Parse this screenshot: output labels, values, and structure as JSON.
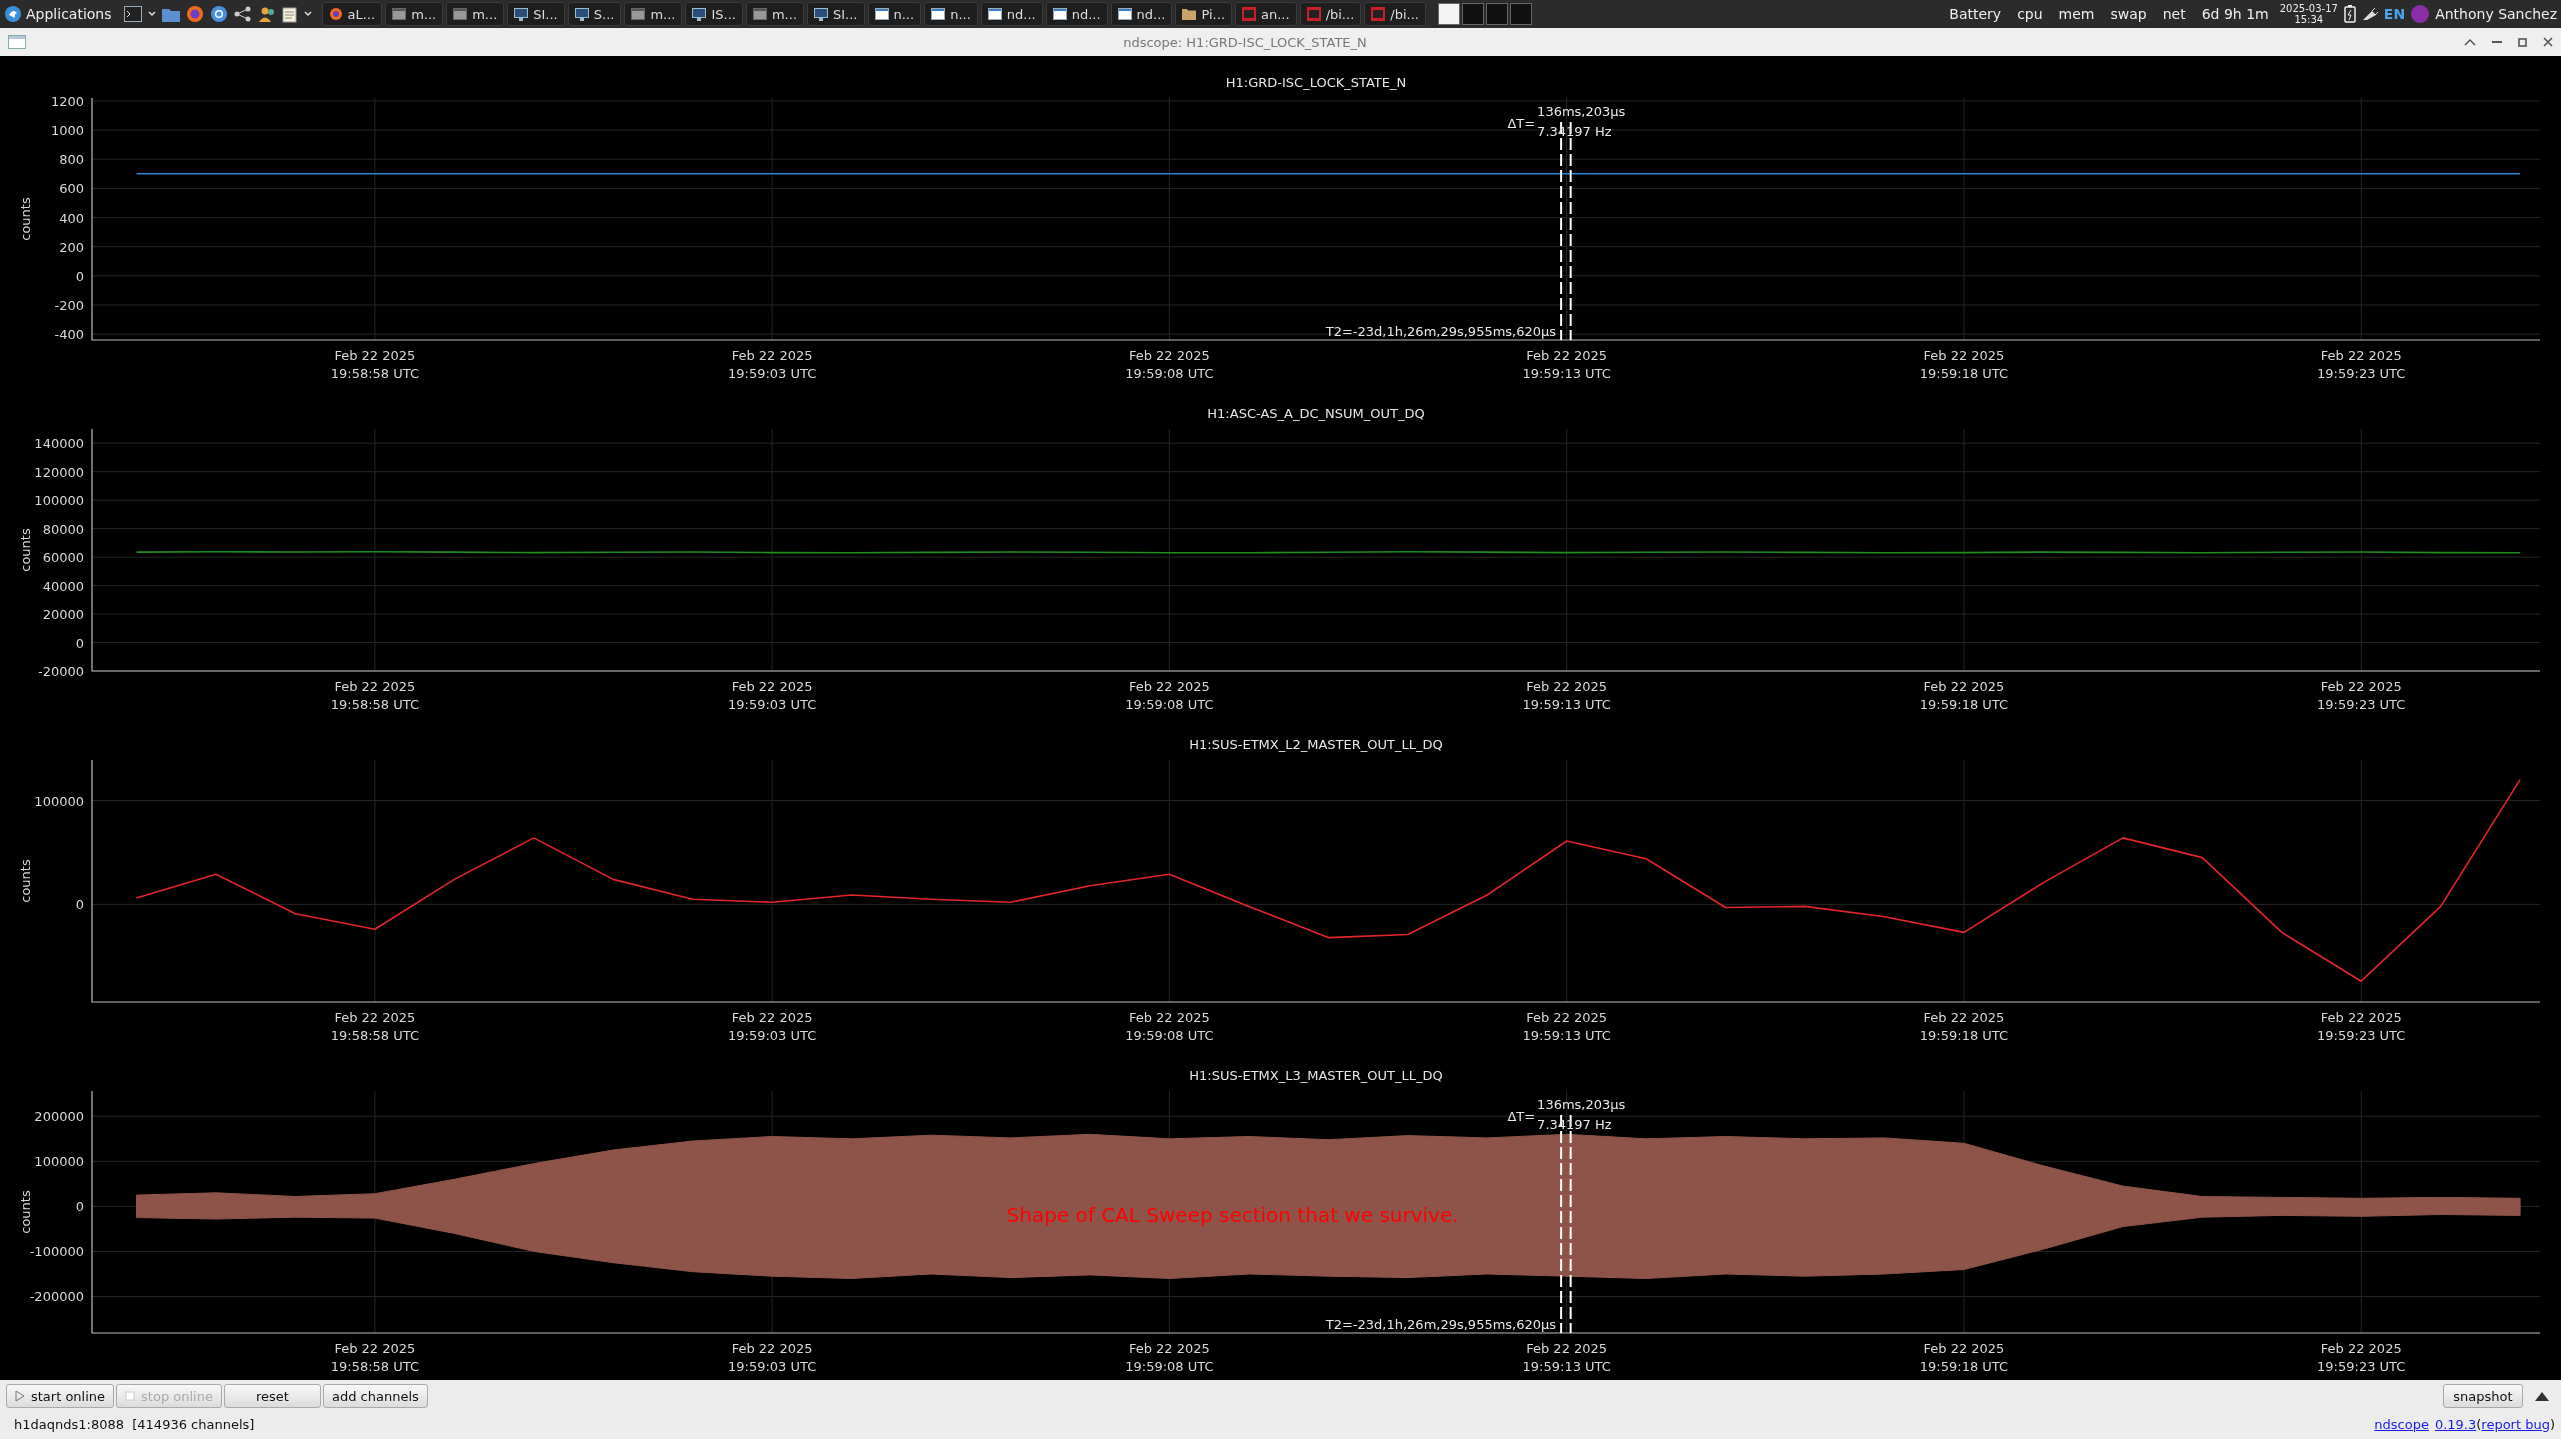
{
  "taskbar": {
    "menu": "Applications",
    "tasks": [
      {
        "kind": "browser",
        "label": "aL..."
      },
      {
        "kind": "window",
        "label": "m..."
      },
      {
        "kind": "window",
        "label": "m..."
      },
      {
        "kind": "monitor",
        "label": "SI..."
      },
      {
        "kind": "monitor",
        "label": "S..."
      },
      {
        "kind": "window",
        "label": "m..."
      },
      {
        "kind": "monitor",
        "label": "IS..."
      },
      {
        "kind": "window",
        "label": "m..."
      },
      {
        "kind": "monitor",
        "label": "SI..."
      },
      {
        "kind": "doc",
        "label": "n..."
      },
      {
        "kind": "doc",
        "label": "n..."
      },
      {
        "kind": "doc",
        "label": "nd..."
      },
      {
        "kind": "doc",
        "label": "nd..."
      },
      {
        "kind": "doc",
        "label": "nd..."
      },
      {
        "kind": "folder",
        "label": "Pi..."
      },
      {
        "kind": "terminal",
        "label": "an..."
      },
      {
        "kind": "terminal",
        "label": "/bi..."
      },
      {
        "kind": "terminal",
        "label": "/bi..."
      }
    ],
    "workspaces": [
      {
        "selected": true
      },
      {
        "selected": false
      },
      {
        "selected": false
      },
      {
        "selected": false
      }
    ],
    "indicators": [
      "Battery",
      "cpu",
      "mem",
      "swap",
      "net"
    ],
    "uptime": "6d 9h 1m",
    "date": "2025-03-17",
    "time": "15:34",
    "keyboard": "EN",
    "user": "Anthony Sanchez"
  },
  "window": {
    "title": "ndscope: H1:GRD-ISC_LOCK_STATE_N"
  },
  "plots": [
    {
      "title": "H1:GRD-ISC_LOCK_STATE_N",
      "chart_data": {
        "type": "line",
        "ylabel": "counts",
        "ylim": [
          -440,
          1220
        ],
        "categories": [
          null,
          null,
          null,
          "Feb 22 2025\n19:58:58 UTC",
          null,
          null,
          null,
          null,
          "Feb 22 2025\n19:59:03 UTC",
          null,
          null,
          null,
          null,
          "Feb 22 2025\n19:59:08 UTC",
          null,
          null,
          null,
          null,
          "Feb 22 2025\n19:59:13 UTC",
          null,
          null,
          null,
          null,
          "Feb 22 2025\n19:59:18 UTC",
          null,
          null,
          null,
          null,
          "Feb 22 2025\n19:59:23 UTC",
          null,
          null
        ],
        "series": [
          {
            "color": "#2f86d0",
            "values": [
              700,
              700,
              700,
              700,
              700,
              700,
              700,
              700,
              700,
              700,
              700,
              700,
              700,
              700,
              700,
              700,
              700,
              700,
              700,
              700,
              700,
              700,
              700,
              700,
              700,
              700,
              700,
              700,
              700,
              700,
              700
            ]
          }
        ],
        "yticks": [
          -400,
          -200,
          0,
          200,
          400,
          600,
          800,
          1000,
          1200
        ],
        "grid": true
      },
      "cursor_readout": {
        "delta_label": "ΔT=",
        "delta": "136ms,203μs",
        "frequency": "7.34197 Hz",
        "t2": "T2=-23d,1h,26m,29s,955ms,620μs"
      }
    },
    {
      "title": "H1:ASC-AS_A_DC_NSUM_OUT_DQ",
      "chart_data": {
        "type": "line",
        "ylabel": "counts",
        "ylim": [
          -20000,
          150000
        ],
        "categories": [
          null,
          null,
          null,
          "Feb 22 2025\n19:58:58 UTC",
          null,
          null,
          null,
          null,
          "Feb 22 2025\n19:59:03 UTC",
          null,
          null,
          null,
          null,
          "Feb 22 2025\n19:59:08 UTC",
          null,
          null,
          null,
          null,
          "Feb 22 2025\n19:59:13 UTC",
          null,
          null,
          null,
          null,
          "Feb 22 2025\n19:59:18 UTC",
          null,
          null,
          null,
          null,
          "Feb 22 2025\n19:59:23 UTC",
          null,
          null
        ],
        "series": [
          {
            "color": "#1f8f1f",
            "values": [
              63500,
              63800,
              63600,
              63800,
              63500,
              63200,
              63400,
              63600,
              63200,
              63000,
              63300,
              63600,
              63400,
              63100,
              63000,
              63400,
              63800,
              63500,
              63200,
              63400,
              63600,
              63300,
              63000,
              63200,
              63500,
              63300,
              63100,
              63400,
              63600,
              63200,
              63000
            ]
          }
        ],
        "yticks": [
          -20000,
          0,
          20000,
          40000,
          60000,
          80000,
          100000,
          120000,
          140000
        ],
        "grid": true
      }
    },
    {
      "title": "H1:SUS-ETMX_L2_MASTER_OUT_LL_DQ",
      "chart_data": {
        "type": "line",
        "ylabel": "counts",
        "ylim": [
          -94000,
          139000
        ],
        "categories": [
          null,
          null,
          null,
          "Feb 22 2025\n19:58:58 UTC",
          null,
          null,
          null,
          null,
          "Feb 22 2025\n19:59:03 UTC",
          null,
          null,
          null,
          null,
          "Feb 22 2025\n19:59:08 UTC",
          null,
          null,
          null,
          null,
          "Feb 22 2025\n19:59:13 UTC",
          null,
          null,
          null,
          null,
          "Feb 22 2025\n19:59:18 UTC",
          null,
          null,
          null,
          null,
          "Feb 22 2025\n19:59:23 UTC",
          null,
          null
        ],
        "series": [
          {
            "color": "#e3262c",
            "values": [
              6000,
              29000,
              -9000,
              -24000,
              24000,
              64000,
              24000,
              5000,
              2000,
              9000,
              5000,
              2000,
              18000,
              29000,
              -2000,
              -32000,
              -29000,
              9000,
              61000,
              44000,
              -3000,
              -2000,
              -12000,
              -27000,
              21000,
              64000,
              45000,
              -27000,
              -74000,
              -2000,
              120000
            ]
          }
        ],
        "yticks": [
          0,
          100000
        ],
        "grid": true
      }
    },
    {
      "title": "H1:SUS-ETMX_L3_MASTER_OUT_LL_DQ",
      "chart_data": {
        "type": "area",
        "ylabel": "counts",
        "ylim": [
          -281000,
          256000
        ],
        "categories": [
          null,
          null,
          null,
          "Feb 22 2025\n19:58:58 UTC",
          null,
          null,
          null,
          null,
          "Feb 22 2025\n19:59:03 UTC",
          null,
          null,
          null,
          null,
          "Feb 22 2025\n19:59:08 UTC",
          null,
          null,
          null,
          null,
          "Feb 22 2025\n19:59:13 UTC",
          null,
          null,
          null,
          null,
          "Feb 22 2025\n19:59:18 UTC",
          null,
          null,
          null,
          null,
          "Feb 22 2025\n19:59:23 UTC",
          null,
          null
        ],
        "series": [
          {
            "color": "#8e5449",
            "values": [
              25000,
              30000,
              22000,
              28000,
              60000,
              95000,
              125000,
              145000,
              155000,
              150000,
              158000,
              152000,
              160000,
              150000,
              155000,
              148000,
              157000,
              152000,
              160000,
              150000,
              155000,
              150000,
              152000,
              140000,
              90000,
              45000,
              22000,
              20000,
              18000,
              20000,
              18000
            ]
          },
          {
            "color": "#8e5449",
            "values": [
              -25000,
              -28000,
              -24000,
              -26000,
              -60000,
              -100000,
              -125000,
              -145000,
              -155000,
              -160000,
              -150000,
              -158000,
              -152000,
              -160000,
              -150000,
              -155000,
              -158000,
              -150000,
              -155000,
              -160000,
              -150000,
              -155000,
              -150000,
              -140000,
              -95000,
              -45000,
              -24000,
              -20000,
              -22000,
              -18000,
              -20000
            ]
          }
        ],
        "yticks": [
          -200000,
          -100000,
          0,
          100000,
          200000
        ],
        "grid": true,
        "annotations": [
          "Shape of CAL Sweep section that we survive."
        ]
      },
      "cursor_readout": {
        "delta_label": "ΔT=",
        "delta": "136ms,203μs",
        "frequency": "7.34197 Hz",
        "t2": "T2=-23d,1h,26m,29s,955ms,620μs"
      }
    }
  ],
  "controls": {
    "buttons": [
      {
        "kind": "play",
        "label": "start online",
        "disabled": false
      },
      {
        "kind": "stop",
        "label": "stop online",
        "disabled": true
      },
      {
        "kind": "text",
        "label": "reset",
        "disabled": false
      },
      {
        "kind": "text",
        "label": "add channels",
        "disabled": false
      }
    ],
    "snapshot": "snapshot"
  },
  "status": {
    "connection": "h1daqnds1:8088  [414936 channels]",
    "app_link": "ndscope",
    "version_link": "0.19.3",
    "open": "(",
    "bug_link": "report bug",
    "close": ")"
  }
}
